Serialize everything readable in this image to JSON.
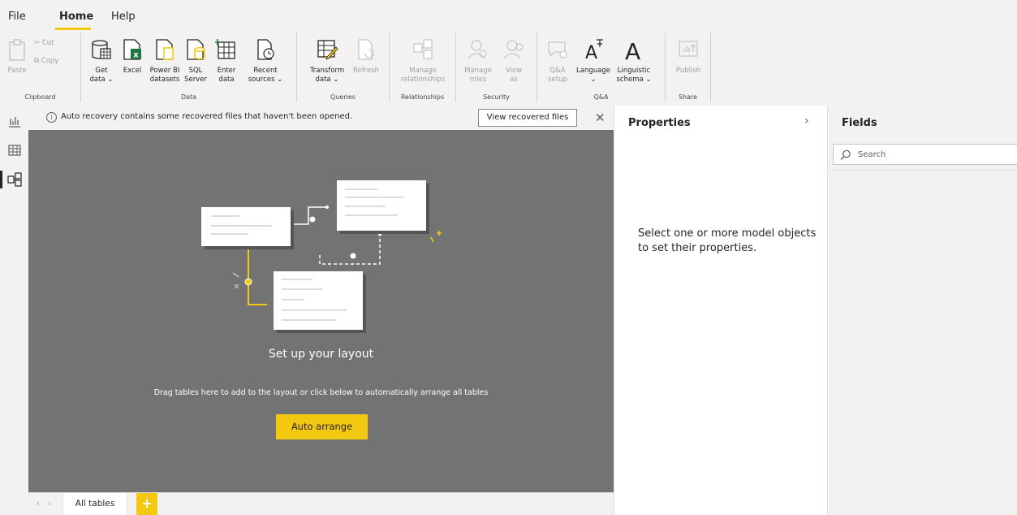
{
  "menu": {
    "file": "File",
    "home": "Home",
    "help": "Help"
  },
  "ribbon": {
    "clipboard": {
      "label": "Clipboard",
      "paste": "Paste",
      "cut": "Cut",
      "copy": "Copy"
    },
    "data": {
      "label": "Data",
      "get_data": [
        "Get",
        "data ⌄"
      ],
      "excel": "Excel",
      "power_bi_datasets": [
        "Power BI",
        "datasets"
      ],
      "sql_server": [
        "SQL",
        "Server"
      ],
      "enter_data": [
        "Enter",
        "data"
      ],
      "recent_sources": [
        "Recent",
        "sources ⌄"
      ]
    },
    "queries": {
      "label": "Queries",
      "transform_data": [
        "Transform",
        "data ⌄"
      ],
      "refresh": "Refresh"
    },
    "relationships": {
      "label": "Relationships",
      "manage_relationships": [
        "Manage",
        "relationships"
      ]
    },
    "security": {
      "label": "Security",
      "manage_roles": [
        "Manage",
        "roles"
      ],
      "view_as": [
        "View",
        "as"
      ]
    },
    "qa": {
      "label": "Q&A",
      "qa_setup": [
        "Q&A",
        "setup"
      ],
      "language": [
        "Language",
        "⌄"
      ],
      "linguistic_schema": [
        "Linguistic",
        "schema ⌄"
      ]
    },
    "share": {
      "label": "Share",
      "publish": "Publish"
    }
  },
  "notification": {
    "text": "Auto recovery contains some recovered files that haven't been opened.",
    "button": "View recovered files",
    "close": "✕"
  },
  "canvas": {
    "title": "Set up your layout",
    "description": "Drag tables here to add to the layout or click below to automatically arrange all tables",
    "button": "Auto arrange"
  },
  "tabs": {
    "prev": "‹",
    "next": "›",
    "all_tables": "All tables",
    "add": "+"
  },
  "properties": {
    "title": "Properties",
    "chevron": "›",
    "message": "Select one or more model objects to set their properties."
  },
  "fields": {
    "title": "Fields",
    "search_placeholder": "Search"
  },
  "colors": {
    "accent": "#f2c811",
    "canvas": "#737373",
    "pane": "#f3f2f1"
  }
}
